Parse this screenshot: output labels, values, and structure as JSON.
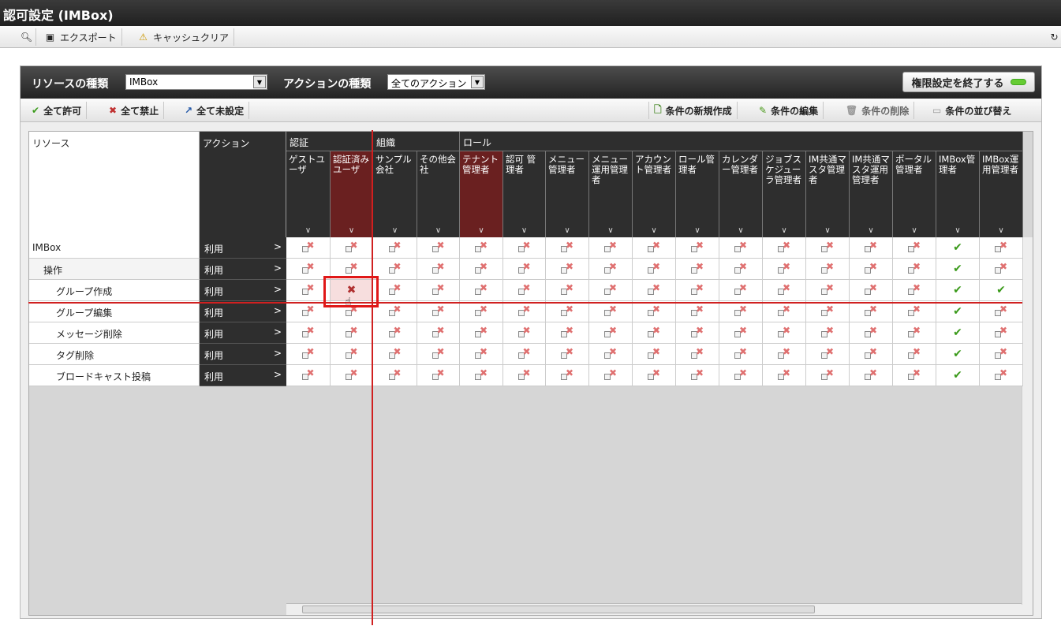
{
  "window": {
    "title": "認可設定 (IMBox)"
  },
  "toolbar": {
    "export": "エクスポート",
    "cache_clear": "キャッシュクリア"
  },
  "resbar": {
    "resource_type_label": "リソースの種類",
    "resource_type_value": "IMBox",
    "action_type_label": "アクションの種類",
    "action_type_value": "全てのアクション",
    "end_button": "権限設定を終了する"
  },
  "actbar": {
    "allow_all": "全て許可",
    "deny_all": "全て禁止",
    "unset_all": "全て未設定",
    "new_condition": "条件の新規作成",
    "edit_condition": "条件の編集",
    "delete_condition": "条件の削除",
    "sort_condition": "条件の並び替え"
  },
  "grid": {
    "resource_header": "リソース",
    "action_header": "アクション",
    "groups": [
      "認証",
      "組織",
      "ロール"
    ],
    "columns": [
      "ゲストユーザ",
      "認証済みユーザ",
      "サンプル会社",
      "その他会社",
      "テナント管理者",
      "認可 管理者",
      "メニュー管理者",
      "メニュー運用管理者",
      "アカウント管理者",
      "ロール管理者",
      "カレンダー管理者",
      "ジョブスケジューラ管理者",
      "IM共通マスタ管理者",
      "IM共通マスタ運用管理者",
      "ポータル管理者",
      "IMBox管理者",
      "IMBox運用管理者"
    ],
    "rows": [
      {
        "resource": "IMBox",
        "action": "利用"
      },
      {
        "resource": "操作",
        "action": "利用"
      },
      {
        "resource": "グループ作成",
        "action": "利用"
      },
      {
        "resource": "グループ編集",
        "action": "利用"
      },
      {
        "resource": "メッセージ削除",
        "action": "利用"
      },
      {
        "resource": "タグ削除",
        "action": "利用"
      },
      {
        "resource": "ブロードキャスト投稿",
        "action": "利用"
      }
    ]
  }
}
